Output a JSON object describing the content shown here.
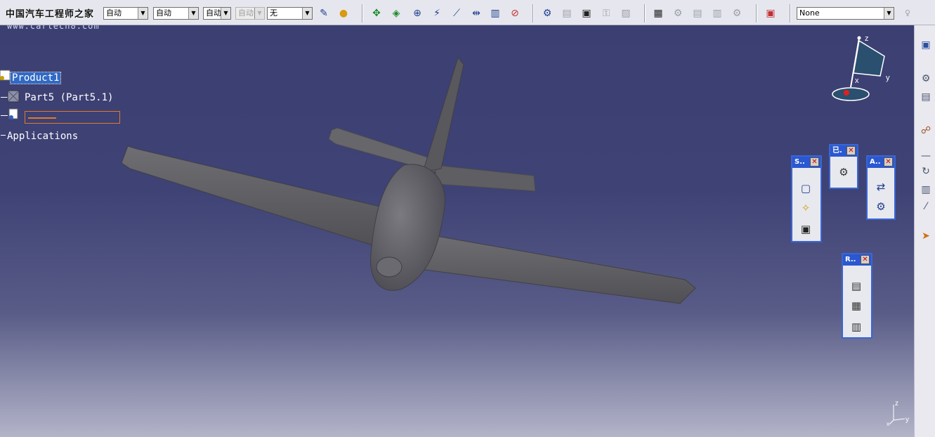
{
  "toolbar": {
    "watermark_title": "中国汽车工程师之家",
    "combos": [
      {
        "value": "自动",
        "disabled": false
      },
      {
        "value": "自动",
        "disabled": false
      },
      {
        "value": "自动",
        "disabled": false
      },
      {
        "value": "自动",
        "disabled": true
      },
      {
        "value": "无",
        "disabled": false
      }
    ],
    "right_combo_value": "None",
    "icons": [
      "painter-icon",
      "paint-drop-icon",
      "move-cross-icon",
      "move-diamond-icon",
      "snap-icon",
      "magic-wand-icon",
      "diagonal-line-icon",
      "spacing-icon",
      "ruler-icon",
      "no-snap-icon",
      "clash-icon",
      "catalog-icon",
      "tree-icon",
      "lock-icon",
      "stamp-icon",
      "properties-icon",
      "paste-icon",
      "layer-icon",
      "grid-icon",
      "gear-stack-icon",
      "database-icon"
    ]
  },
  "viewport": {
    "watermark_url": "www.cartech8.com",
    "tree": {
      "root": "Product1",
      "child1": "Part5 (Part5.1)",
      "child2_label": "",
      "applications": "Applications"
    },
    "compass": {
      "z": "z",
      "x": "x",
      "y": "y"
    },
    "axis_triad": {
      "z": "z",
      "y": "y",
      "x": "x"
    }
  },
  "panels": [
    {
      "title": "S..",
      "icons": [
        "cube-icon",
        "light-icon",
        "camera-icon"
      ]
    },
    {
      "title": "已.",
      "icons": [
        "cursor-gear-icon"
      ]
    },
    {
      "title": "A..",
      "icons": [
        "swap-icon",
        "gear-cluster-icon"
      ]
    },
    {
      "title": "R..",
      "icons": [
        "film-icon",
        "film-cut-icon",
        "film-star-icon"
      ]
    }
  ],
  "colors": {
    "panel_border": "#3a66d4",
    "viewport_top": "#3c3f71",
    "viewport_bottom": "#b3b4c9",
    "selection": "#316ac5"
  }
}
